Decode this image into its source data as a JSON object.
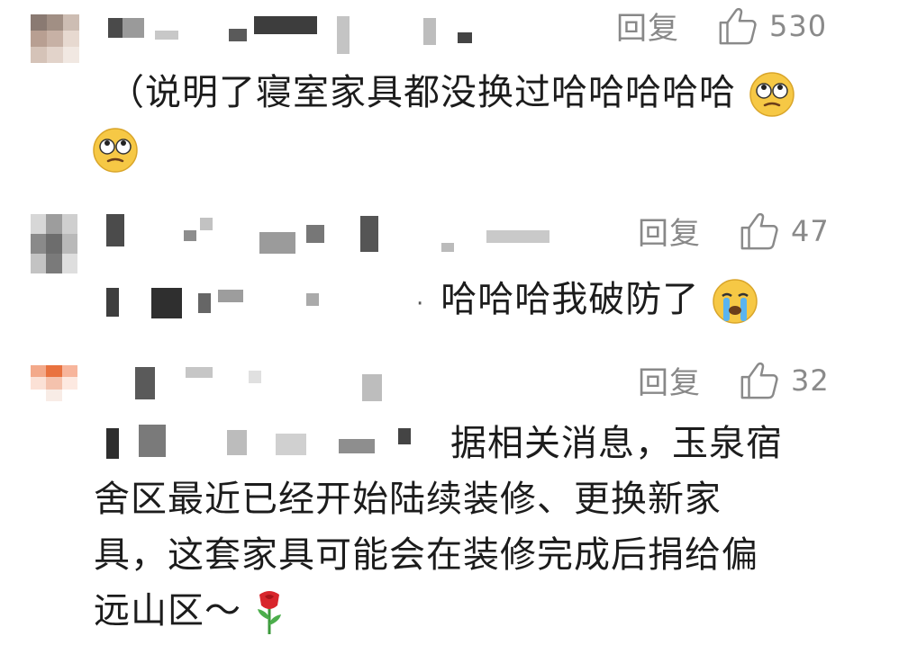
{
  "comments": [
    {
      "reply_label": "回复",
      "likes": "530",
      "text": "（说明了寝室家具都没换过哈哈哈哈哈",
      "emojis": [
        "eye-roll-emoji",
        "eye-roll-emoji"
      ]
    },
    {
      "reply_label": "回复",
      "likes": "47",
      "text_prefix": "·",
      "text": "哈哈哈我破防了",
      "emojis": [
        "crying-emoji"
      ]
    },
    {
      "reply_label": "回复",
      "likes": "32",
      "text_line1": "据相关消息，玉泉宿",
      "text_line2": "舍区最近已经开始陆续装修、更换新家",
      "text_line3": "具，这套家具可能会在装修完成后捐给偏",
      "text_line4": "远山区～",
      "emojis": [
        "rose-emoji"
      ]
    }
  ],
  "colors": {
    "meta_gray": "#888888",
    "text": "#1c1c1c",
    "mosaic_dark": "#3a3a3a",
    "mosaic_light": "#cfcfcf"
  }
}
